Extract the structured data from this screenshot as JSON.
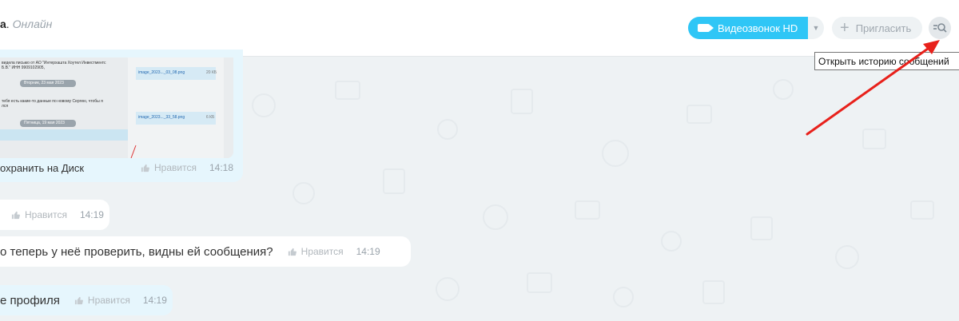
{
  "header": {
    "name_suffix": "а",
    "status": "Онлайн",
    "video_call_label": "Видеозвонок HD",
    "invite_label": "Пригласить",
    "history_tooltip": "Открыть историю сообщений"
  },
  "thumbnail": {
    "letter_line1": "видела письмо от АО \"Интерхашта Хоутел Инвестментс",
    "letter_line2": "Б.В.\" ИНН 9909102905,",
    "date1": "Вторник, 23 мая 2023",
    "line3": "тебя есть какие-то данные по новому Сергею, чтобы я",
    "line4": "лся",
    "date2": "Пятница, 19 мая 2023",
    "file1_name": "image_2023..._03_08.png",
    "file1_size": "20 КБ",
    "file2_name": "image_2023..._33_58.png",
    "file2_size": "6 КБ"
  },
  "messages": [
    {
      "text": "охранить на Диск",
      "like": "Нравится",
      "time": "14:18"
    },
    {
      "text": "",
      "like": "Нравится",
      "time": "14:19"
    },
    {
      "text": "о теперь у неё проверить, видны ей сообщения?",
      "like": "Нравится",
      "time": "14:19"
    },
    {
      "text": "е профиля",
      "like": "Нравится",
      "time": "14:19"
    }
  ],
  "colors": {
    "accent": "#2fc6f6",
    "own_bubble": "#e6f6fd",
    "arrow": "#e8211b"
  },
  "icons": [
    "camera-icon",
    "chevron-down-icon",
    "plus-icon",
    "history-search-icon",
    "like-icon"
  ]
}
